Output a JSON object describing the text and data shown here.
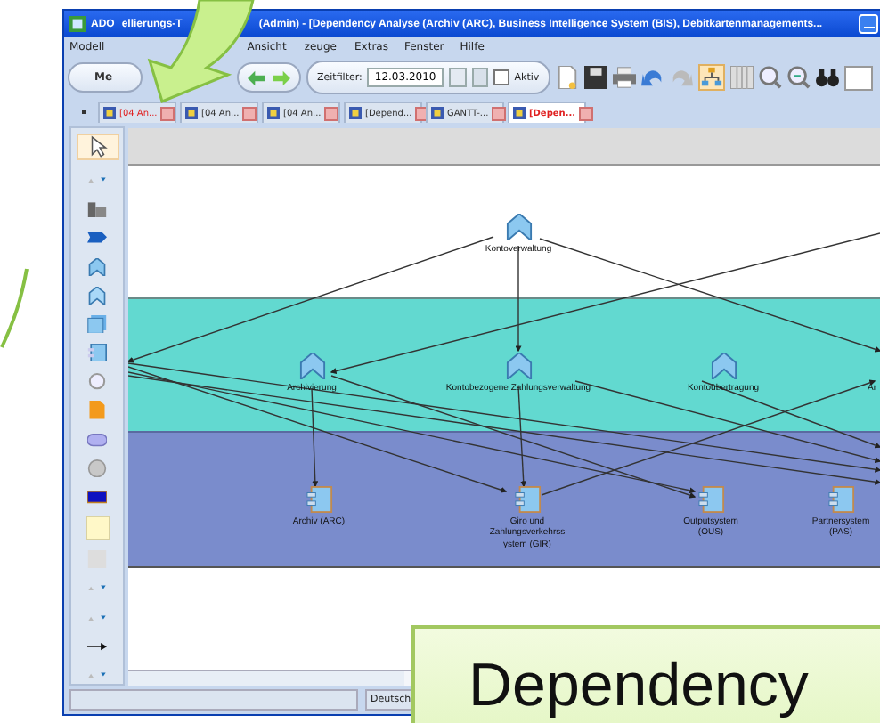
{
  "window": {
    "title_parts": [
      "ADO",
      "ellierungs-T",
      "(Admin) - [Dependency Analyse (Archiv (ARC), Business Intelligence System (BIS), Debitkartenmanagements..."
    ]
  },
  "menu": [
    {
      "label": "Modell"
    },
    {
      "label": "Ansicht"
    },
    {
      "label": "zeuge"
    },
    {
      "label": "Extras"
    },
    {
      "label": "Fenster"
    },
    {
      "label": "Hilfe"
    }
  ],
  "toolbar": {
    "mode_label": "Me",
    "filter_label": "Zeitfilter:",
    "date": "12.03.2010",
    "active": {
      "label": "Aktiv",
      "checked": false
    }
  },
  "tabs": [
    {
      "label": "[04 An...",
      "selected": false,
      "color": "#e02020"
    },
    {
      "label": "[04 An...",
      "selected": false,
      "color": "#333333"
    },
    {
      "label": "[04 An...",
      "selected": false,
      "color": "#333333"
    },
    {
      "label": "[Depend...",
      "selected": false,
      "color": "#333333"
    },
    {
      "label": "GANTT-...",
      "selected": false,
      "color": "#333333"
    },
    {
      "label": "[Depen...",
      "selected": true,
      "color": "#e02020"
    }
  ],
  "diagram": {
    "nodes": [
      {
        "label": "Kontoverwaltung",
        "kind": "capability"
      },
      {
        "label": "Archivierung",
        "kind": "capability"
      },
      {
        "label": "Kontobezogene Zahlungsverwaltung",
        "kind": "capability"
      },
      {
        "label": "Kontoübertragung",
        "kind": "capability"
      },
      {
        "label": "Ar",
        "kind": "label"
      },
      {
        "label": "Archiv (ARC)",
        "kind": "system"
      },
      {
        "label": "Giro und Zahlungsverkehrssystem (GIR)",
        "kind": "system"
      },
      {
        "label": "Outputsystem (OUS)",
        "kind": "system"
      },
      {
        "label": "Partnersystem (PAS)",
        "kind": "system"
      }
    ]
  },
  "status_bar": {
    "language": "Deutsch"
  },
  "callout": {
    "text": "Dependency"
  }
}
